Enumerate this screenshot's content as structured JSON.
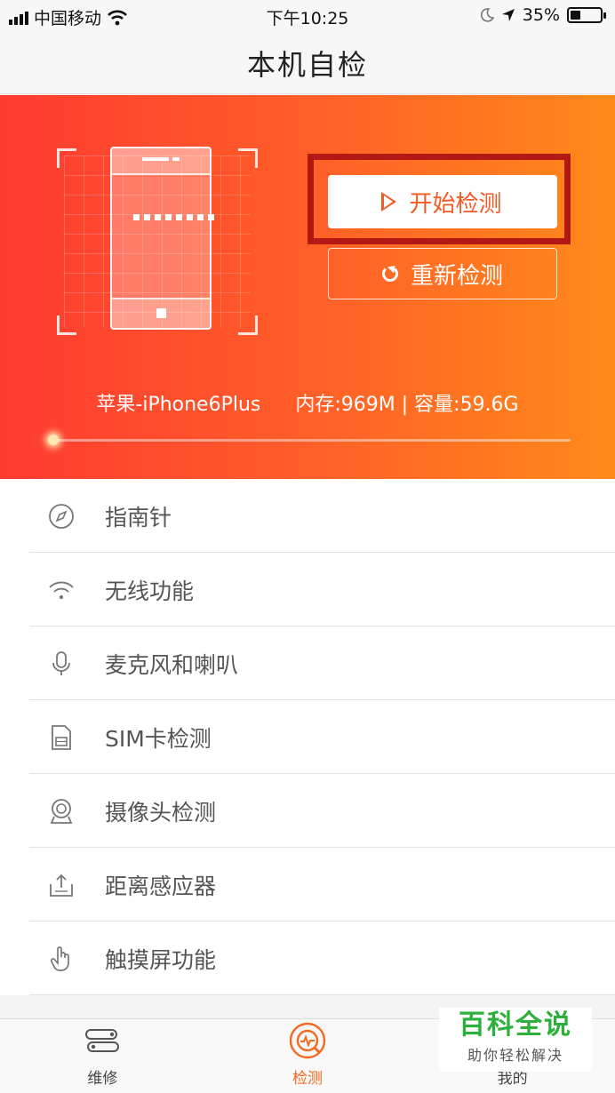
{
  "status_bar": {
    "carrier": "中国移动",
    "time": "下午10:25",
    "battery": "35%",
    "battery_level": 0.35
  },
  "nav": {
    "title": "本机自检"
  },
  "hero": {
    "start_label": "开始检测",
    "retest_label": "重新检测",
    "device_name": "苹果-iPhone6Plus",
    "device_specs": "内存:969M | 容量:59.6G",
    "progress": 0
  },
  "list": [
    {
      "label": "指南针",
      "icon": "compass-icon"
    },
    {
      "label": "无线功能",
      "icon": "wifi-icon"
    },
    {
      "label": "麦克风和喇叭",
      "icon": "microphone-icon"
    },
    {
      "label": "SIM卡检测",
      "icon": "sim-card-icon"
    },
    {
      "label": "摄像头检测",
      "icon": "camera-icon"
    },
    {
      "label": "距离感应器",
      "icon": "proximity-sensor-icon"
    },
    {
      "label": "触摸屏功能",
      "icon": "touch-hand-icon"
    }
  ],
  "tabs": [
    {
      "label": "维修",
      "icon": "repair-tools-icon",
      "active": false
    },
    {
      "label": "检测",
      "icon": "detect-icon",
      "active": true
    },
    {
      "label": "我的",
      "icon": "profile-icon",
      "active": false
    }
  ],
  "watermark": {
    "main": "百科全说",
    "sub": "助你轻松解决"
  },
  "colors": {
    "accent": "#f26a21",
    "hero_start": "#ff3b30",
    "hero_end": "#ff8a1a",
    "highlight": "#b21914",
    "watermark": "#2bb03a"
  }
}
